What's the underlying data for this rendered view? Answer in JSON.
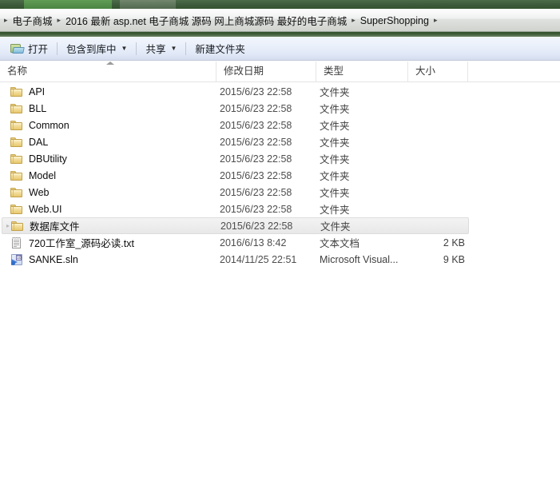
{
  "window": {
    "chrome_color": "#3d5b3a"
  },
  "breadcrumb": {
    "separator": "▸",
    "items": [
      "电子商城",
      "2016 最新 asp.net 电子商城 源码 网上商城源码 最好的电子商城",
      "SuperShopping"
    ]
  },
  "toolbar": {
    "open_label": "打开",
    "include_library_label": "包含到库中",
    "share_label": "共享",
    "new_folder_label": "新建文件夹",
    "caret": "▼"
  },
  "columns": {
    "name": "名称",
    "date_modified": "修改日期",
    "type": "类型",
    "size": "大小",
    "sorted_by": "名称",
    "sort_direction": "ascending"
  },
  "files": [
    {
      "name": "API",
      "date": "2015/6/23 22:58",
      "type": "文件夹",
      "size": "",
      "icon": "folder",
      "selected": false
    },
    {
      "name": "BLL",
      "date": "2015/6/23 22:58",
      "type": "文件夹",
      "size": "",
      "icon": "folder",
      "selected": false
    },
    {
      "name": "Common",
      "date": "2015/6/23 22:58",
      "type": "文件夹",
      "size": "",
      "icon": "folder",
      "selected": false
    },
    {
      "name": "DAL",
      "date": "2015/6/23 22:58",
      "type": "文件夹",
      "size": "",
      "icon": "folder",
      "selected": false
    },
    {
      "name": "DBUtility",
      "date": "2015/6/23 22:58",
      "type": "文件夹",
      "size": "",
      "icon": "folder",
      "selected": false
    },
    {
      "name": "Model",
      "date": "2015/6/23 22:58",
      "type": "文件夹",
      "size": "",
      "icon": "folder",
      "selected": false
    },
    {
      "name": "Web",
      "date": "2015/6/23 22:58",
      "type": "文件夹",
      "size": "",
      "icon": "folder",
      "selected": false
    },
    {
      "name": "Web.UI",
      "date": "2015/6/23 22:58",
      "type": "文件夹",
      "size": "",
      "icon": "folder",
      "selected": false
    },
    {
      "name": "数据库文件",
      "date": "2015/6/23 22:58",
      "type": "文件夹",
      "size": "",
      "icon": "folder",
      "selected": true
    },
    {
      "name": "720工作室_源码必读.txt",
      "date": "2016/6/13 8:42",
      "type": "文本文档",
      "size": "2 KB",
      "icon": "text",
      "selected": false
    },
    {
      "name": "SANKE.sln",
      "date": "2014/11/25 22:51",
      "type": "Microsoft Visual...",
      "size": "9 KB",
      "icon": "solution",
      "selected": false
    }
  ]
}
